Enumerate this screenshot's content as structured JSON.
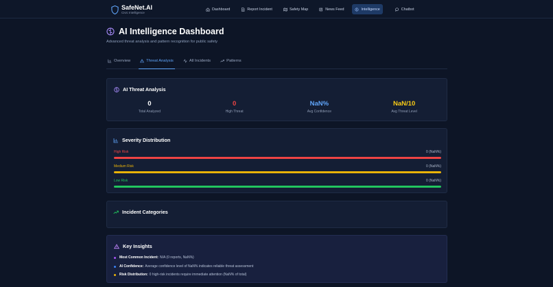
{
  "nav": {
    "brand_name": "SafeNet.AI",
    "brand_tagline": "Civic Intelligence",
    "links": [
      {
        "label": "Dashboard",
        "icon": "home-icon"
      },
      {
        "label": "Report Incident",
        "icon": "document-icon"
      },
      {
        "label": "Safety Map",
        "icon": "map-icon"
      },
      {
        "label": "News Feed",
        "icon": "newspaper-icon"
      },
      {
        "label": "Intelligence",
        "icon": "brain-icon",
        "active": true
      },
      {
        "label": "Chatbot",
        "icon": "chat-icon"
      }
    ]
  },
  "header": {
    "title": "AI Intelligence Dashboard",
    "subtitle": "Advanced threat analysis and pattern recognition for public safety"
  },
  "tabs": [
    {
      "label": "Overview",
      "icon": "bar-chart-icon"
    },
    {
      "label": "Threat Analysis",
      "icon": "warning-triangle-icon",
      "active": true
    },
    {
      "label": "All Incidents",
      "icon": "activity-icon"
    },
    {
      "label": "Patterns",
      "icon": "trend-up-icon"
    }
  ],
  "threat": {
    "title": "AI Threat Analysis",
    "stats": [
      {
        "value": "0",
        "label": "Total Analyzed",
        "color": "#ffffff"
      },
      {
        "value": "0",
        "label": "High Threat",
        "color": "#ef4444"
      },
      {
        "value": "NaN%",
        "label": "Avg Confidence",
        "color": "#60a5fa"
      },
      {
        "value": "NaN/10",
        "label": "Avg Threat Level",
        "color": "#facc15"
      }
    ]
  },
  "severity": {
    "title": "Severity Distribution",
    "rows": [
      {
        "label": "High Risk",
        "pct": "0 (NaN%)",
        "color": "#ef4444"
      },
      {
        "label": "Medium Risk",
        "pct": "0 (NaN%)",
        "color": "#eab308"
      },
      {
        "label": "Low Risk",
        "pct": "0 (NaN%)",
        "color": "#22c55e"
      }
    ]
  },
  "categories": {
    "title": "Incident Categories"
  },
  "insights": {
    "title": "Key Insights",
    "items": [
      {
        "key": "Most Common Incident:",
        "text": "N/A (0 reports, NaN%)",
        "color": "#a855f7"
      },
      {
        "key": "AI Confidence:",
        "text": "Average confidence level of NaN% indicates reliable threat assessment",
        "color": "#3b82f6"
      },
      {
        "key": "Risk Distribution:",
        "text": "0 high-risk incidents require immediate attention (NaN% of total)",
        "color": "#eab308"
      }
    ]
  }
}
